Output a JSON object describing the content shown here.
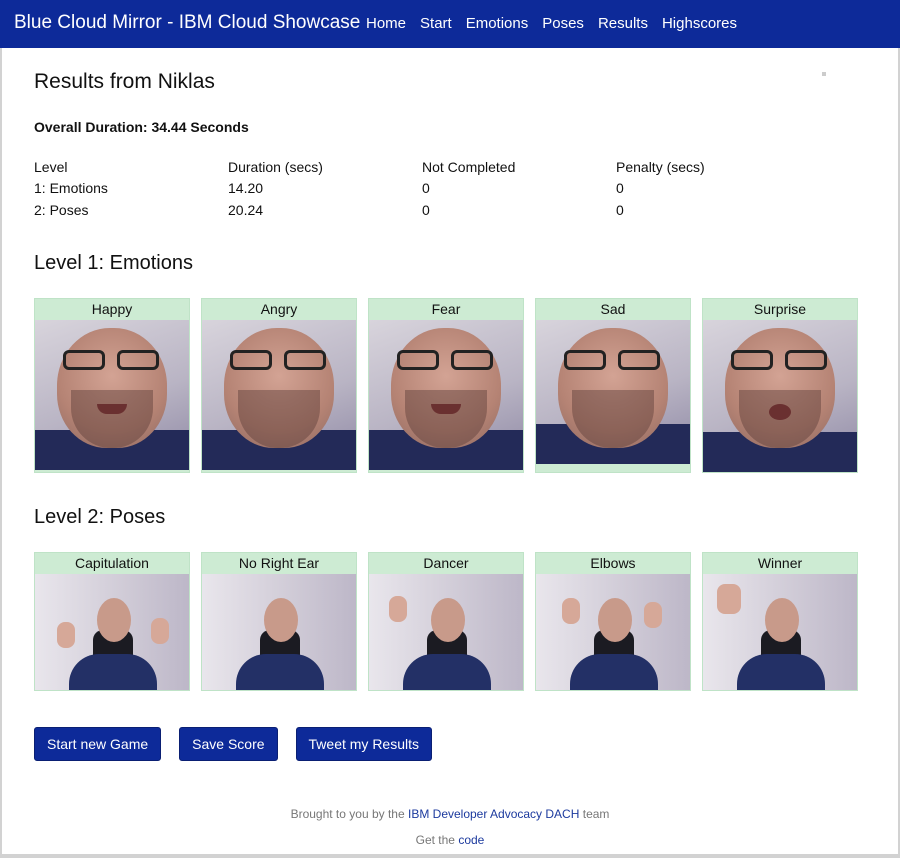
{
  "navbar": {
    "brand": "Blue Cloud Mirror - IBM Cloud Showcase",
    "links": [
      "Home",
      "Start",
      "Emotions",
      "Poses",
      "Results",
      "Highscores"
    ]
  },
  "results": {
    "title": "Results from Niklas",
    "overall": "Overall Duration: 34.44 Seconds",
    "headers": [
      "Level",
      "Duration (secs)",
      "Not Completed",
      "Penalty (secs)"
    ],
    "rows": [
      [
        "1: Emotions",
        "14.20",
        "0",
        "0"
      ],
      [
        "2: Poses",
        "20.24",
        "0",
        "0"
      ]
    ]
  },
  "level1": {
    "title": "Level 1: Emotions",
    "items": [
      "Happy",
      "Angry",
      "Fear",
      "Sad",
      "Surprise"
    ]
  },
  "level2": {
    "title": "Level 2: Poses",
    "items": [
      "Capitulation",
      "No Right Ear",
      "Dancer",
      "Elbows",
      "Winner"
    ]
  },
  "buttons": {
    "new_game": "Start new Game",
    "save_score": "Save Score",
    "tweet": "Tweet my Results"
  },
  "footer": {
    "line1_pre": "Brought to you by the",
    "line1_link": "IBM Developer Advocacy DACH",
    "line1_post": "team",
    "line2_pre": "Get the",
    "line2_link": "code"
  },
  "colors": {
    "navbar": "#0d2a99",
    "card_label_bg": "#cdebd3",
    "button": "#0d2a99"
  }
}
